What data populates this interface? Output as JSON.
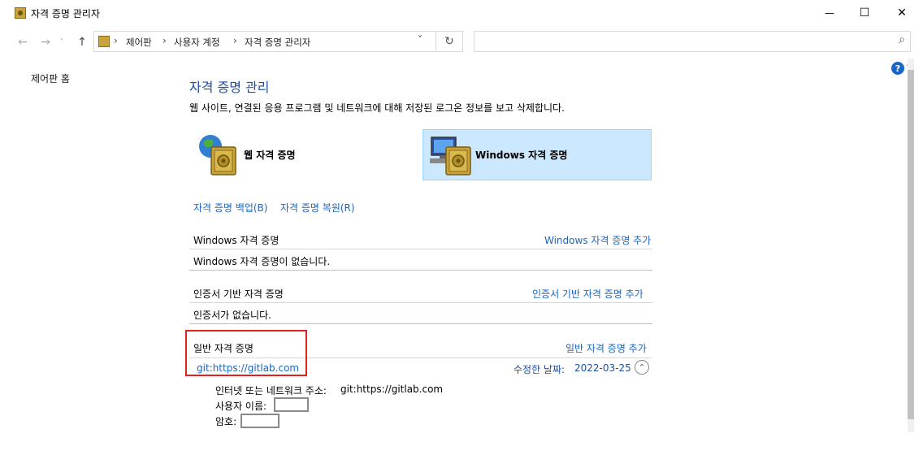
{
  "window": {
    "title": "자격 증명 관리자",
    "controls": {
      "minimize": "—",
      "maximize": "☐",
      "close": "✕"
    }
  },
  "nav": {
    "back": "←",
    "forward": "→",
    "dropdown": "˅",
    "up": "↑",
    "breadcrumbs": [
      "제어판",
      "사용자 계정",
      "자격 증명 관리자"
    ],
    "separator": "›",
    "address_dropdown": "˅",
    "refresh": "↻",
    "search_icon": "⌕"
  },
  "sidebar": {
    "home_link": "제어판 홈"
  },
  "main": {
    "heading": "자격 증명 관리",
    "description": "웹 사이트, 연결된 응용 프로그램 및 네트워크에 대해 저장된 로그온 정보를 보고 삭제합니다.",
    "tiles": {
      "web": {
        "label": "웹 자격 증명",
        "icon": "globe-vault-icon"
      },
      "windows": {
        "label": "Windows 자격 증명",
        "icon": "monitor-vault-icon",
        "selected": true
      }
    },
    "actions": {
      "backup": "자격 증명 백업(B)",
      "restore": "자격 증명 복원(R)"
    },
    "sections": {
      "windows": {
        "title": "Windows 자격 증명",
        "add_link": "Windows 자격 증명 추가",
        "empty_text": "Windows 자격 증명이 없습니다."
      },
      "certificate": {
        "title": "인증서 기반 자격 증명",
        "add_link": "인증서 기반 자격 증명 추가",
        "empty_text": "인증서가 없습니다."
      },
      "generic": {
        "title": "일반 자격 증명",
        "add_link": "일반 자격 증명 추가",
        "entry": {
          "name": "git:https://gitlab.com",
          "modified_label": "수정한 날짜:",
          "modified_date": "2022-03-25",
          "collapse_icon": "⌃",
          "address_label": "인터넷 또는 네트워크 주소:",
          "address_value": "git:https://gitlab.com",
          "username_label": "사용자 이름:",
          "password_label": "암호:"
        }
      }
    }
  },
  "colors": {
    "link": "#1a66c4",
    "heading": "#1e4f9c",
    "highlight_box": "#e0211e",
    "selected_tile": "#cce8ff"
  }
}
